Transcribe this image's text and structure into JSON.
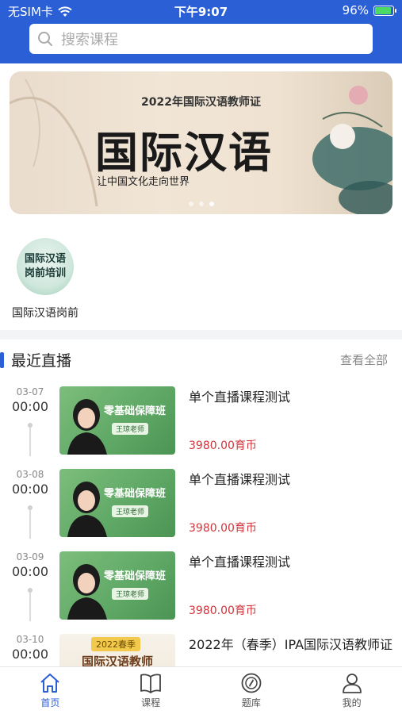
{
  "status_bar": {
    "carrier": "无SIM卡",
    "time": "下午9:07",
    "battery": "96%",
    "battery_level": 0.96
  },
  "search": {
    "placeholder": "搜索课程"
  },
  "banner": {
    "subtitle": "2022年国际汉语教师证",
    "title": "国际汉语",
    "slogan": "让中国文化走向世界",
    "dot_count": 3,
    "active_dot": 2
  },
  "categories": [
    {
      "icon_text": "国际汉语岗前培训",
      "label": "国际汉语岗前"
    }
  ],
  "section": {
    "title": "最近直播",
    "view_all": "查看全部"
  },
  "live_items": [
    {
      "date": "03-07",
      "time": "00:00",
      "thumb_tag": "零基础保障班",
      "thumb_badge": "王琼老师",
      "title": "单个直播课程测试",
      "price": "3980.00育币"
    },
    {
      "date": "03-08",
      "time": "00:00",
      "thumb_tag": "零基础保障班",
      "thumb_badge": "王琼老师",
      "title": "单个直播课程测试",
      "price": "3980.00育币"
    },
    {
      "date": "03-09",
      "time": "00:00",
      "thumb_tag": "零基础保障班",
      "thumb_badge": "王琼老师",
      "title": "单个直播课程测试",
      "price": "3980.00育币"
    },
    {
      "date": "03-10",
      "time": "00:00",
      "thumb_year": "2022春季",
      "thumb_name": "国际汉语教师",
      "title": "2022年（春季）IPA国际汉语教师证"
    }
  ],
  "tabbar": [
    {
      "label": "首页",
      "icon": "home-icon",
      "active": true
    },
    {
      "label": "课程",
      "icon": "book-icon",
      "active": false
    },
    {
      "label": "题库",
      "icon": "compass-icon",
      "active": false
    },
    {
      "label": "我的",
      "icon": "user-icon",
      "active": false
    }
  ],
  "colors": {
    "primary": "#2b5fd6",
    "price": "#d0343a"
  }
}
